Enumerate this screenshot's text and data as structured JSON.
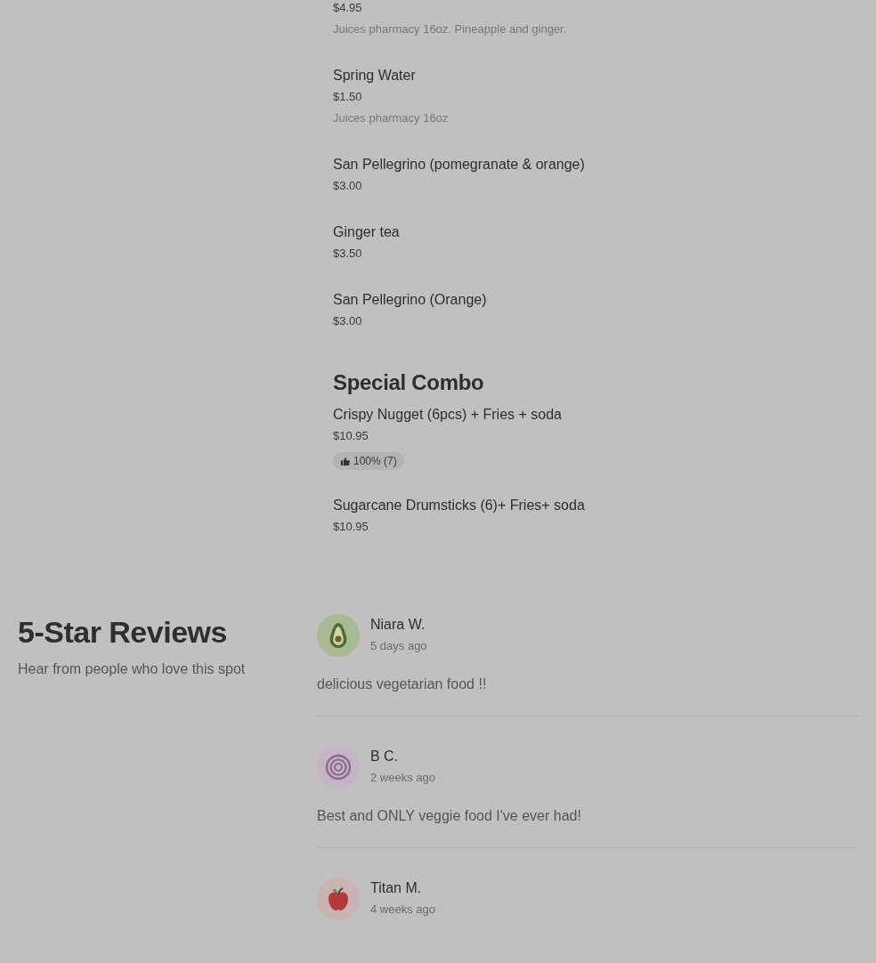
{
  "menu_sections": [
    {
      "items": [
        {
          "price": "$4.95",
          "description": "Juices pharmacy 16oz. Pineapple and ginger."
        },
        {
          "name": "Spring Water",
          "price": "$1.50",
          "description": "Juices pharmacy 16oz"
        },
        {
          "name": "San Pellegrino (pomegranate & orange)",
          "price": "$3.00"
        },
        {
          "name": "Ginger tea",
          "price": "$3.50"
        },
        {
          "name": "San Pellegrino (Orange)",
          "price": "$3.00"
        }
      ]
    },
    {
      "title": "Special Combo",
      "items": [
        {
          "name": "Crispy Nugget (6pcs) + Fries + soda",
          "price": "$10.95",
          "rating": "100% (7)"
        },
        {
          "name": "Sugarcane Drumsticks (6)+ Fries+ soda",
          "price": "$10.95"
        }
      ]
    }
  ],
  "reviews": {
    "title": "5-Star Reviews",
    "subtitle": "Hear from people who love this spot",
    "items": [
      {
        "kind": "avocado",
        "name": "Niara W.",
        "time": "5 days ago",
        "text": "delicious vegetarian food !!"
      },
      {
        "kind": "onion",
        "name": "B C.",
        "time": "2 weeks ago",
        "text": "Best and ONLY veggie food I've ever had!"
      },
      {
        "kind": "apple",
        "name": "Titan M.",
        "time": "4 weeks ago"
      }
    ]
  }
}
